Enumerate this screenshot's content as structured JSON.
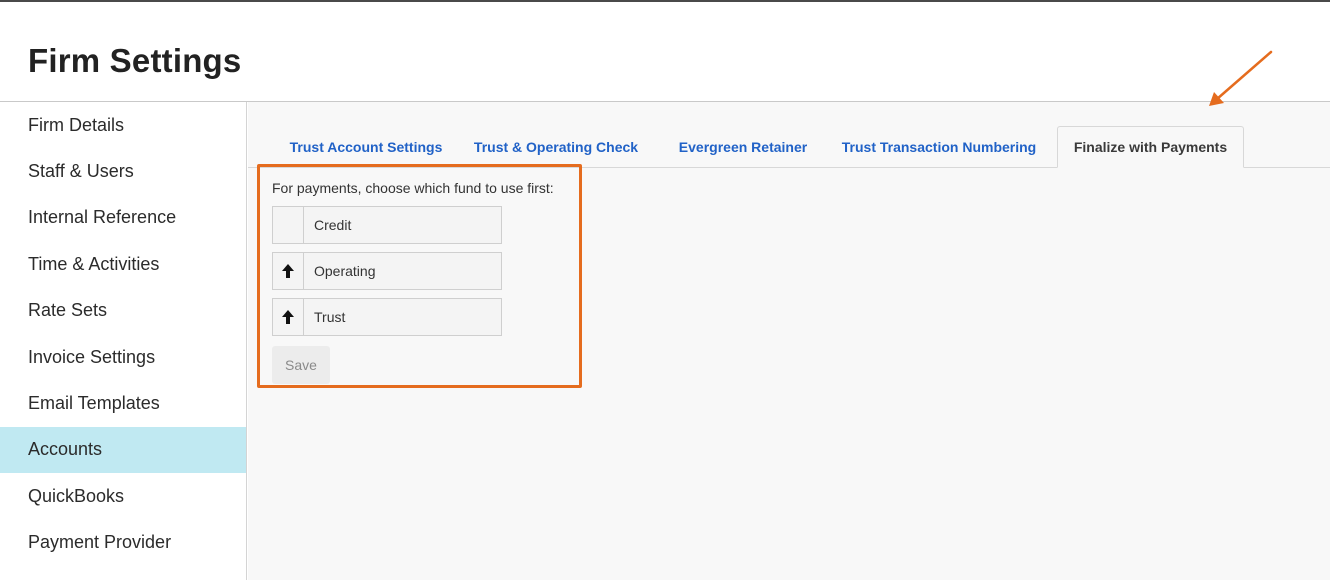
{
  "page": {
    "title": "Firm Settings"
  },
  "sidebar": {
    "items": [
      {
        "label": "Firm Details",
        "active": false
      },
      {
        "label": "Staff & Users",
        "active": false
      },
      {
        "label": "Internal Reference",
        "active": false
      },
      {
        "label": "Time & Activities",
        "active": false
      },
      {
        "label": "Rate Sets",
        "active": false
      },
      {
        "label": "Invoice Settings",
        "active": false
      },
      {
        "label": "Email Templates",
        "active": false
      },
      {
        "label": "Accounts",
        "active": true
      },
      {
        "label": "QuickBooks",
        "active": false
      },
      {
        "label": "Payment Provider",
        "active": false
      }
    ]
  },
  "tabs": [
    {
      "label": "Trust Account Settings",
      "active": false
    },
    {
      "label": "Trust & Operating Check",
      "active": false
    },
    {
      "label": "Evergreen Retainer",
      "active": false
    },
    {
      "label": "Trust Transaction Numbering",
      "active": false
    },
    {
      "label": "Finalize with Payments",
      "active": true
    }
  ],
  "payments": {
    "instruction": "For payments, choose which fund to use first:",
    "funds": [
      {
        "label": "Credit",
        "icon": ""
      },
      {
        "label": "Operating",
        "icon": "arrow-up-icon"
      },
      {
        "label": "Trust",
        "icon": "arrow-up-icon"
      }
    ],
    "save_label": "Save"
  },
  "colors": {
    "accent_link": "#2162c7",
    "active_sidebar": "#c0e9f2",
    "highlight": "#e56c1e"
  }
}
